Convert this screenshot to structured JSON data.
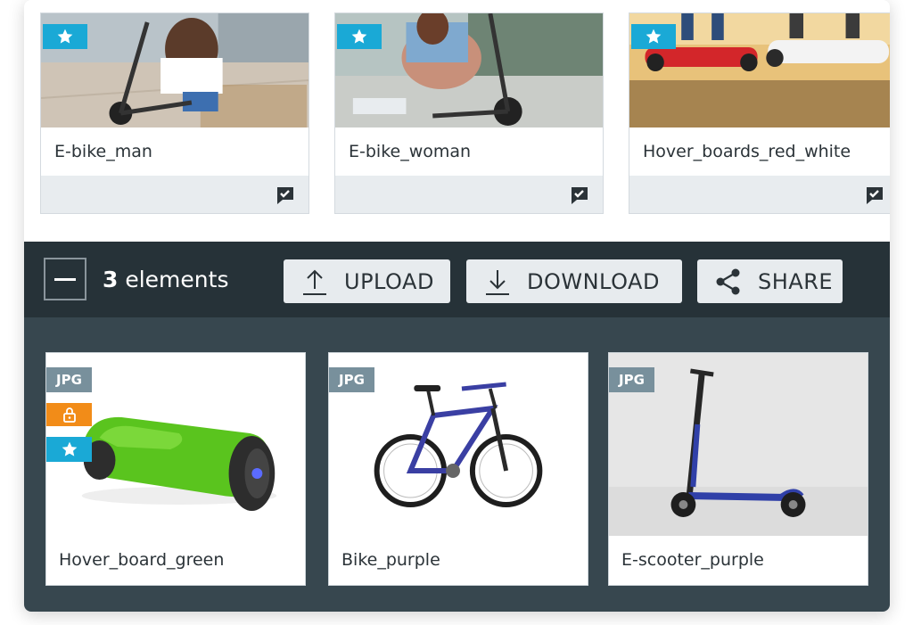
{
  "top_cards": [
    {
      "name": "E-bike_man"
    },
    {
      "name": "E-bike_woman"
    },
    {
      "name": "Hover_boards_red_white"
    }
  ],
  "toolbar": {
    "count_number": "3",
    "count_label": " elements",
    "upload_label": "UPLOAD",
    "download_label": "DOWNLOAD",
    "share_label": "SHARE"
  },
  "bottom_cards": [
    {
      "name": "Hover_board_green",
      "type": "JPG",
      "locked": true,
      "starred": true
    },
    {
      "name": "Bike_purple",
      "type": "JPG",
      "locked": false,
      "starred": false
    },
    {
      "name": "E-scooter_purple",
      "type": "JPG",
      "locked": false,
      "starred": false
    }
  ],
  "colors": {
    "toolbar_bg": "#263238",
    "bottom_bg": "#37474f",
    "star_badge": "#1aa9d6",
    "lock_badge": "#f28c18",
    "jpg_badge": "#78909c",
    "button_bg": "#e7ebee"
  },
  "icons": {
    "star": "star-icon",
    "check": "approved-comment-icon",
    "collapse": "minus-icon",
    "upload": "upload-icon",
    "download": "download-icon",
    "share": "share-icon",
    "lock": "lock-icon"
  }
}
